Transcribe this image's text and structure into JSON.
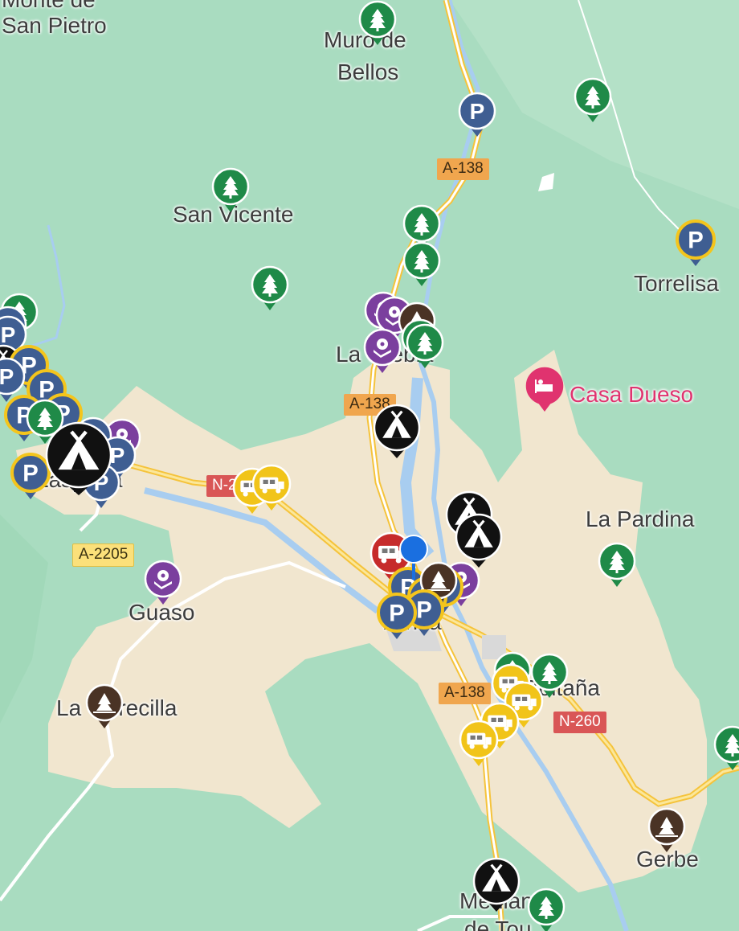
{
  "map": {
    "place_labels": {
      "monte_san_pietro_top": "Monte de",
      "monte_san_pietro": "San Pietro",
      "muro_de_bellos_1": "Muro de",
      "muro_de_bellos_2": "Bellos",
      "san_vicente": "San Vicente",
      "torrelisa": "Torrelisa",
      "la_pardina": "La Pardina",
      "casa_dueso": "Casa Dueso",
      "la_crebia": "La Crebia",
      "laspuña": "Laspuña",
      "guaso": "Guaso",
      "la_torrecilla": "La Torrecilla",
      "ainsa": "Aínsa",
      "boltaña": "Boltaña",
      "gerbe": "Gerbe",
      "mediano_1": "Mediano",
      "mediano_2": "de Tou"
    },
    "road_labels": {
      "a138_north": "A-138",
      "a138_middle": "A-138",
      "a138_south": "A-138",
      "a2205": "A-2205",
      "n260_west": "N-260",
      "n260_east": "N-260"
    },
    "colors": {
      "forest": "#a9dcc0",
      "urban": "#f1e6cf",
      "water": "#a8cdf0",
      "highway": "#f5c33b",
      "parking_pin": "#3f5e92",
      "parking_ring": "#f4c51c",
      "tree_pin": "#1f8a48",
      "camp_pin": "#111111",
      "rv_pin": "#f1c419",
      "service_pin": "#7b3f9e",
      "nature_pin": "#4a3325",
      "hotel_pin": "#e0336f",
      "current_location": "#1a6fe0"
    }
  }
}
